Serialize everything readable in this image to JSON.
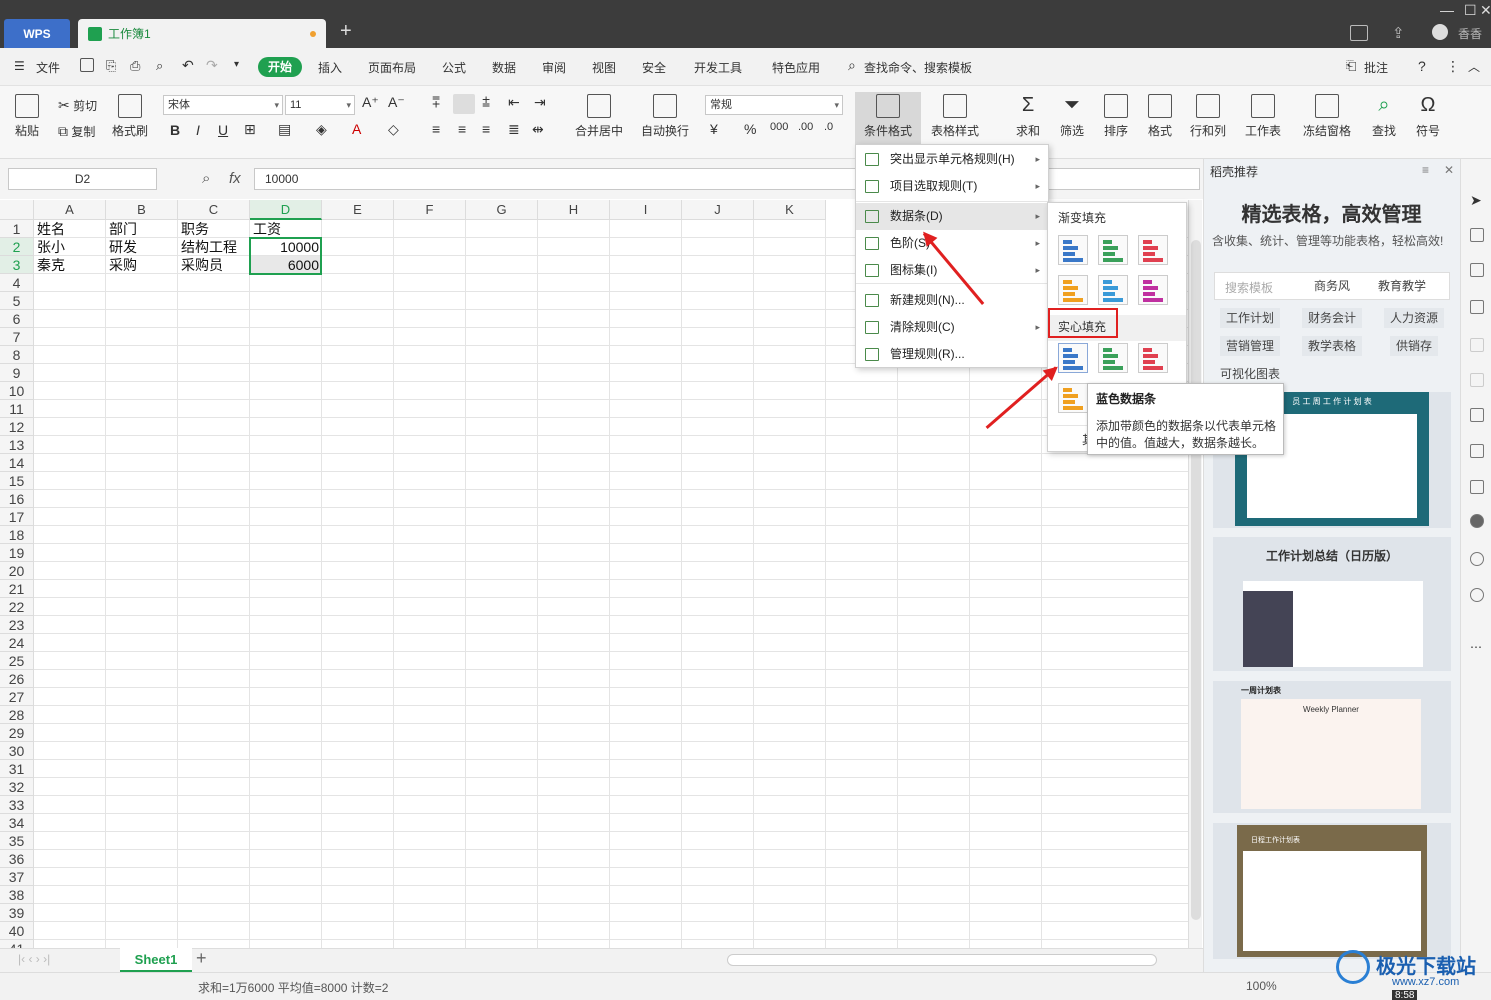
{
  "titlebar": {
    "app_tab": "WPS",
    "doc_tab": "工作簿1",
    "new_tab": "+",
    "user": "香香"
  },
  "menubar": {
    "file": "文件",
    "tabs": [
      "开始",
      "插入",
      "页面布局",
      "公式",
      "数据",
      "审阅",
      "视图",
      "安全",
      "开发工具",
      "特色应用"
    ],
    "search": "查找命令、搜索模板",
    "comment": "批注",
    "help": "?"
  },
  "ribbon": {
    "paste": "粘贴",
    "cut": "剪切",
    "copy": "复制",
    "format_painter": "格式刷",
    "font_name": "宋体",
    "font_size": "11",
    "number_format": "常规",
    "merge": "合并居中",
    "wrap": "自动换行",
    "cond_format": "条件格式",
    "table_style": "表格样式",
    "sum": "求和",
    "filter": "筛选",
    "sort": "排序",
    "format": "格式",
    "row_col": "行和列",
    "sheet": "工作表",
    "freeze": "冻结窗格",
    "find": "查找",
    "symbol": "符号"
  },
  "formula": {
    "cell_ref": "D2",
    "fx": "fx",
    "value": "10000"
  },
  "columns": [
    "A",
    "B",
    "C",
    "D",
    "E",
    "F",
    "G",
    "H",
    "I",
    "J",
    "K"
  ],
  "rows": [
    [
      "姓名",
      "部门",
      "职务",
      "工资"
    ],
    [
      "张小",
      "研发",
      "结构工程",
      "10000"
    ],
    [
      "秦克",
      "采购",
      "采购员",
      "6000"
    ]
  ],
  "row_numbers": [
    "1",
    "2",
    "3",
    "4",
    "5",
    "6",
    "7",
    "8",
    "9",
    "10",
    "11",
    "12",
    "13",
    "14",
    "15",
    "16",
    "17",
    "18",
    "19",
    "20",
    "21",
    "22",
    "23",
    "24",
    "25",
    "26",
    "27",
    "28",
    "29",
    "30",
    "31",
    "32",
    "33",
    "34",
    "35",
    "36",
    "37",
    "38",
    "39",
    "40",
    "41"
  ],
  "sheet": {
    "name": "Sheet1",
    "add": "+"
  },
  "status": {
    "summary": "求和=1万6000  平均值=8000  计数=2",
    "zoom": "100%",
    "time": "8:58"
  },
  "cond_menu": [
    {
      "label": "突出显示单元格规则(H)",
      "arrow": true
    },
    {
      "label": "项目选取规则(T)",
      "arrow": true
    },
    {
      "label": "数据条(D)",
      "arrow": true
    },
    {
      "label": "色阶(S)",
      "arrow": true
    },
    {
      "label": "图标集(I)",
      "arrow": true
    },
    {
      "label": "新建规则(N)...",
      "arrow": false
    },
    {
      "label": "清除规则(C)",
      "arrow": true
    },
    {
      "label": "管理规则(R)...",
      "arrow": false
    }
  ],
  "databar_menu": {
    "gradient": "渐变填充",
    "solid": "实心填充",
    "more": "其"
  },
  "tooltip": {
    "title": "蓝色数据条",
    "body": "添加带颜色的数据条以代表单元格中的值。值越大，数据条越长。"
  },
  "panel": {
    "header": "稻壳推荐",
    "title": "精选表格，高效管理",
    "subtitle": "含收集、统计、管理等功能表格，轻松高效!",
    "search_placeholder": "搜索模板",
    "chips": [
      "商务风",
      "教育教学",
      "工作计划",
      "财务会计",
      "人力资源",
      "营销管理",
      "教学表格",
      "供销存",
      "可视化图表"
    ],
    "card1_text": "员 工 周 工 作 计 划 表",
    "card2_title": "工作计划总结（日历版）",
    "card3_title": "一周计划表",
    "card3_sub": "Weekly  Planner",
    "card4_title": "日程工作计划表"
  },
  "watermark": "极光下载站",
  "watermark_url": "www.xz7.com",
  "colors": {
    "accent": "#1fa050",
    "highlight": "#e02020"
  }
}
